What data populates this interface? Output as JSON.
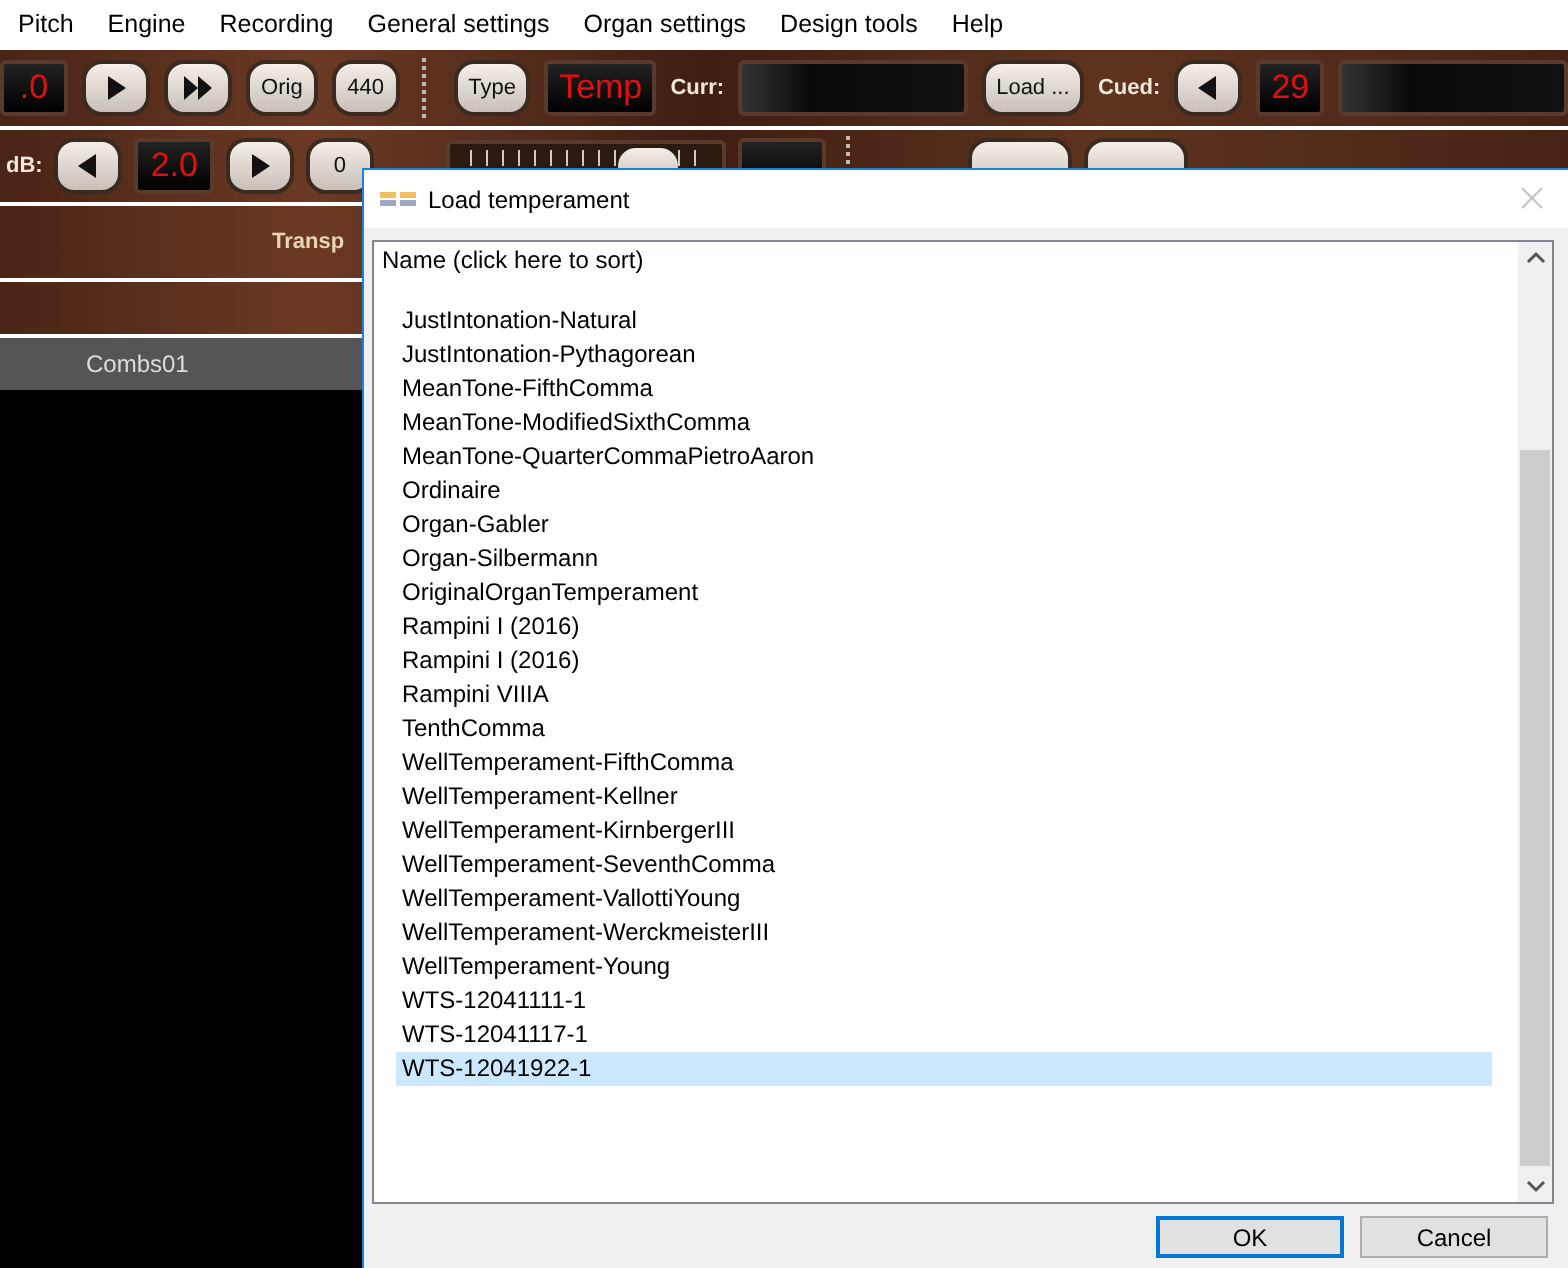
{
  "menu": [
    "Pitch",
    "Engine",
    "Recording",
    "General settings",
    "Organ settings",
    "Design tools",
    "Help"
  ],
  "toolbar_row_1": [
    {
      "kind": "display",
      "text": ".0"
    },
    {
      "kind": "play"
    },
    {
      "kind": "forward"
    },
    {
      "kind": "button",
      "text": "Orig"
    },
    {
      "kind": "button",
      "text": "440"
    },
    {
      "kind": "grip"
    },
    {
      "kind": "button",
      "text": "Type"
    },
    {
      "kind": "display",
      "text": "Temp"
    },
    {
      "kind": "label",
      "text": "Curr:"
    },
    {
      "kind": "screen"
    },
    {
      "kind": "button",
      "text": "Load ..."
    },
    {
      "kind": "label",
      "text": "Cued:"
    },
    {
      "kind": "back"
    },
    {
      "kind": "display",
      "text": "29"
    },
    {
      "kind": "screen"
    }
  ],
  "toolbar_row_2": [
    {
      "kind": "label",
      "text": "dB:"
    },
    {
      "kind": "back"
    },
    {
      "kind": "display",
      "text": "2.0"
    },
    {
      "kind": "play"
    },
    {
      "kind": "button",
      "text": "0"
    },
    {
      "kind": "slider",
      "level": 0.75
    },
    {
      "kind": "display"
    },
    {
      "kind": "grip"
    },
    {
      "kind": "button"
    },
    {
      "kind": "button"
    }
  ],
  "panel_label": "Transp",
  "tab": "Combs01",
  "dialog": {
    "title": "Load temperament",
    "column_header": "Name (click here to sort)",
    "items": [
      {
        "name": "JustIntonation-Natural",
        "selected": false
      },
      {
        "name": "JustIntonation-Pythagorean",
        "selected": false
      },
      {
        "name": "MeanTone-FifthComma",
        "selected": false
      },
      {
        "name": "MeanTone-ModifiedSixthComma",
        "selected": false
      },
      {
        "name": "MeanTone-QuarterCommaPietroAaron",
        "selected": false
      },
      {
        "name": "Ordinaire",
        "selected": false
      },
      {
        "name": "Organ-Gabler",
        "selected": false
      },
      {
        "name": "Organ-Silbermann",
        "selected": false
      },
      {
        "name": "OriginalOrganTemperament",
        "selected": false
      },
      {
        "name": "Rampini I (2016)",
        "selected": false
      },
      {
        "name": "Rampini I (2016)",
        "selected": false
      },
      {
        "name": "Rampini VIIIA",
        "selected": false
      },
      {
        "name": "TenthComma",
        "selected": false
      },
      {
        "name": "WellTemperament-FifthComma",
        "selected": false
      },
      {
        "name": "WellTemperament-Kellner",
        "selected": false
      },
      {
        "name": "WellTemperament-KirnbergerIII",
        "selected": false
      },
      {
        "name": "WellTemperament-SeventhComma",
        "selected": false
      },
      {
        "name": "WellTemperament-VallottiYoung",
        "selected": false
      },
      {
        "name": "WellTemperament-WerckmeisterIII",
        "selected": false
      },
      {
        "name": "WellTemperament-Young",
        "selected": false
      },
      {
        "name": "WTS-12041111-1",
        "selected": false
      },
      {
        "name": "WTS-12041117-1",
        "selected": false
      },
      {
        "name": "WTS-12041922-1",
        "selected": true
      }
    ],
    "buttons": [
      {
        "label": "OK",
        "focused": true
      },
      {
        "label": "Cancel",
        "focused": false
      }
    ]
  }
}
